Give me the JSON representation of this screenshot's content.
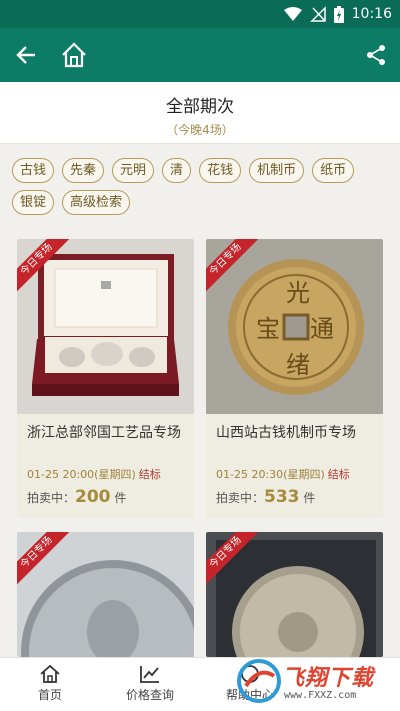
{
  "status_bar": {
    "time": "10:16"
  },
  "header": {
    "title": "全部期次",
    "subtitle": "（今晚4场）"
  },
  "filters": [
    "古钱",
    "先秦",
    "元明",
    "清",
    "花钱",
    "机制币",
    "纸币",
    "银锭",
    "高级检索"
  ],
  "cards": [
    {
      "ribbon": "今日专场",
      "title": "浙江总部邻国工艺品专场",
      "time": "01-25 20:00(星期四)",
      "end_label": "结标",
      "count_prefix": "拍卖中：",
      "count": "200",
      "count_suffix": " 件"
    },
    {
      "ribbon": "今日专场",
      "title": "山西站古钱机制币专场",
      "time": "01-25 20:30(星期四)",
      "end_label": "结标",
      "count_prefix": "拍卖中：",
      "count": "533",
      "count_suffix": " 件"
    },
    {
      "ribbon": "今日专场"
    },
    {
      "ribbon": "今日专场"
    }
  ],
  "bottom_nav": [
    {
      "label": "首页",
      "icon": "home-icon"
    },
    {
      "label": "价格查询",
      "icon": "chart-icon"
    },
    {
      "label": "帮助中心",
      "icon": "help-icon"
    }
  ],
  "watermark": {
    "text": "飞翔下载",
    "url": "www.FXXZ.com"
  },
  "colors": {
    "primary": "#0d7c66",
    "gold": "#a88a3c",
    "ribbon": "#c4242a"
  }
}
